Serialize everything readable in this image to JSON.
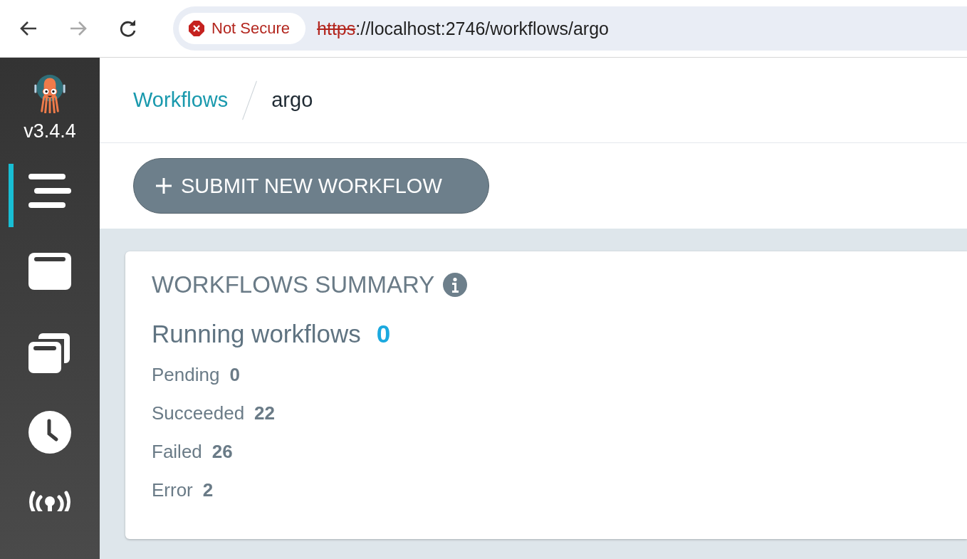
{
  "browser": {
    "security_label": "Not Secure",
    "url_scheme": "https",
    "url_rest": "://localhost:2746/workflows/argo"
  },
  "sidebar": {
    "version": "v3.4.4",
    "items": [
      {
        "kind": "list",
        "selected": true
      },
      {
        "kind": "window",
        "selected": false
      },
      {
        "kind": "copies",
        "selected": false
      },
      {
        "kind": "clock",
        "selected": false
      },
      {
        "kind": "signal",
        "selected": false
      }
    ]
  },
  "breadcrumb": [
    {
      "kind": "link",
      "label": "Workflows"
    },
    {
      "kind": "current",
      "label": "argo"
    }
  ],
  "toolbar": {
    "submit_label": "SUBMIT NEW WORKFLOW"
  },
  "summary": {
    "title": "WORKFLOWS SUMMARY",
    "running_label": "Running workflows",
    "running_count": "0",
    "stats": [
      {
        "label": "Pending",
        "count": "0"
      },
      {
        "label": "Succeeded",
        "count": "22"
      },
      {
        "label": "Failed",
        "count": "26"
      },
      {
        "label": "Error",
        "count": "2"
      }
    ]
  }
}
